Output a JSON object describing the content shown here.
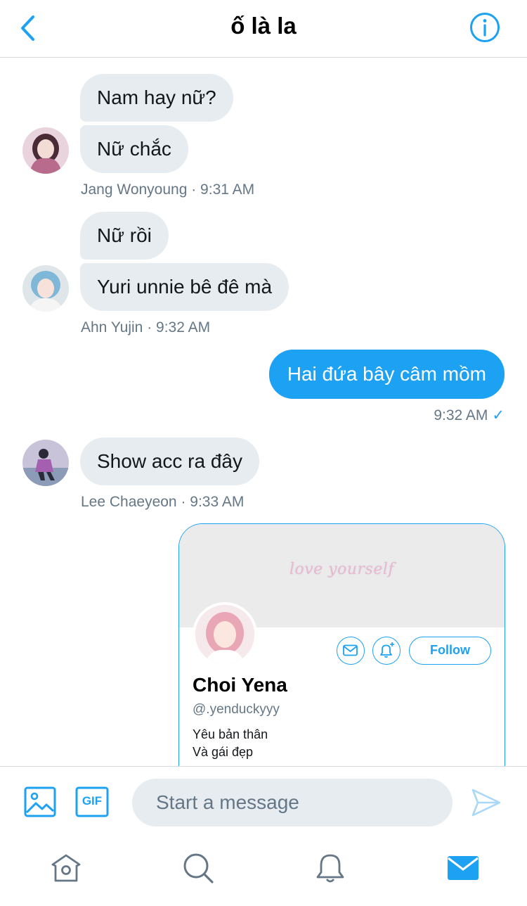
{
  "header": {
    "title": "ố là la",
    "back_icon": "chevron-left-icon",
    "info_icon": "info-icon",
    "accent": "#1da1f2"
  },
  "messages": [
    {
      "text": "Nam hay nữ?"
    },
    {
      "text": "Nữ chắc"
    },
    {
      "meta": "Jang Wonyoung · 9:31 AM"
    },
    {
      "text": "Nữ rồi"
    },
    {
      "text": "Yuri unnie bê đê mà"
    },
    {
      "meta": "Ahn Yujin · 9:32 AM"
    },
    {
      "text": "Hai đứa bây câm mồm"
    },
    {
      "meta": "9:32 AM",
      "read_mark": "✓"
    },
    {
      "text": "Show acc ra đây"
    },
    {
      "meta": "Lee Chaeyeon · 9:33 AM"
    }
  ],
  "profile_card": {
    "banner_text": "love yourself",
    "name": "Choi Yena",
    "handle": "@.yenduckyyy",
    "bio_line1": "Yêu bản thân",
    "bio_line2": "Và gái đẹp",
    "follow_label": "Follow",
    "message_icon": "mail-icon",
    "notify_icon": "bell-plus-icon"
  },
  "composer": {
    "placeholder": "Start a message",
    "gif_label": "GIF",
    "image_icon": "image-icon",
    "send_icon": "send-icon"
  },
  "tabbar": {
    "items": [
      "home-icon",
      "search-icon",
      "bell-icon",
      "mail-icon"
    ],
    "active": "mail-icon"
  },
  "colors": {
    "bubble_in": "#e6ecf0",
    "bubble_out": "#1da1f2",
    "meta": "#657786"
  }
}
